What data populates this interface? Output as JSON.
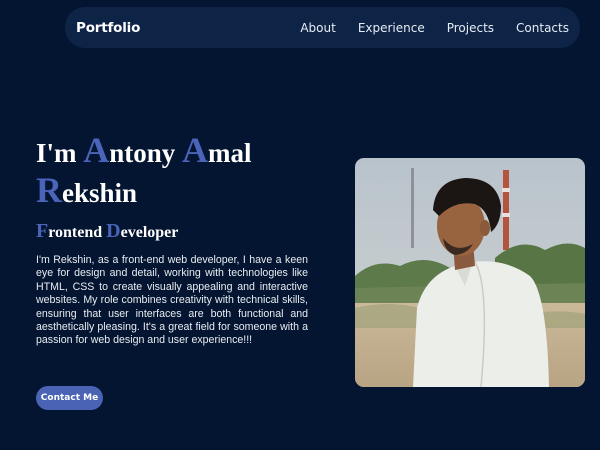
{
  "nav": {
    "logo": "Portfolio",
    "links": [
      "About",
      "Experience",
      "Projects",
      "Contacts"
    ]
  },
  "hero": {
    "title": {
      "line1_prefix": "I'm ",
      "first_initial": "A",
      "first_rest": "ntony ",
      "second_initial": "A",
      "second_rest": "mal",
      "third_initial": "R",
      "third_rest": "ekshin"
    },
    "subtitle": {
      "f_cap": "F",
      "f_rest": "rontend ",
      "d_cap": "D",
      "d_rest": "eveloper"
    },
    "bio": "I'm Rekshin, as a front-end web developer, I have a keen eye for design and detail, working with technologies like HTML, CSS to create visually appealing and interactive websites. My role combines creativity with technical skills, ensuring that user interfaces are both functional and aesthetically pleasing. It's a great field for someone with a passion for web design and user experience!!!",
    "cta_label": "Contact Me"
  },
  "colors": {
    "background": "#031530",
    "navbar": "#0d2447",
    "accent": "#4b63b8"
  }
}
